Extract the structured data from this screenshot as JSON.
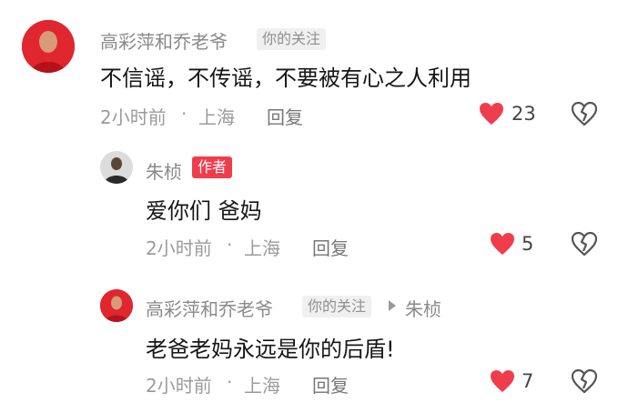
{
  "comments": [
    {
      "user": "高彩萍和乔老爷",
      "relation_tag": "你的关注",
      "text": "不信谣，不传谣，不要被有心之人利用",
      "time": "2小时前",
      "location": "上海",
      "reply_label": "回复",
      "likes": "23"
    },
    {
      "user": "朱桢",
      "author_tag": "作者",
      "text": "爱你们 爸妈",
      "time": "2小时前",
      "location": "上海",
      "reply_label": "回复",
      "likes": "5"
    },
    {
      "user": "高彩萍和乔老爷",
      "relation_tag": "你的关注",
      "reply_to": "朱桢",
      "text": "老爸老妈永远是你的后盾!",
      "time": "2小时前",
      "location": "上海",
      "reply_label": "回复",
      "likes": "7"
    }
  ],
  "meta_separator": "·",
  "colors": {
    "like_red": "#f03d4c",
    "author_badge": "#f03d4c",
    "muted_text": "#9b9b9b"
  },
  "icons": {
    "like": "heart-icon",
    "dislike": "broken-heart-icon",
    "reply_arrow": "play-arrow-icon"
  }
}
